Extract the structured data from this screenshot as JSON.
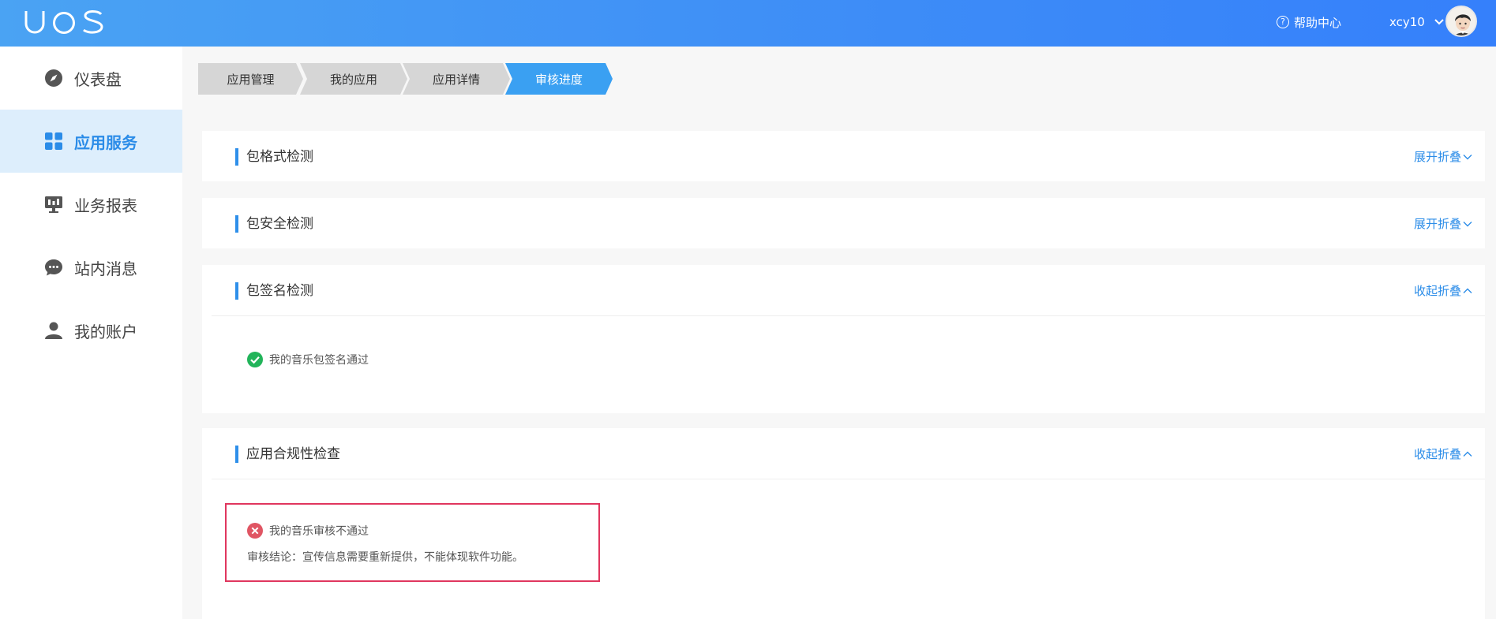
{
  "header": {
    "logo_text": "UOS",
    "help_label": "帮助中心",
    "username": "xcy10"
  },
  "sidebar": {
    "items": [
      {
        "label": "仪表盘",
        "icon": "compass-icon",
        "active": false
      },
      {
        "label": "应用服务",
        "icon": "grid-icon",
        "active": true
      },
      {
        "label": "业务报表",
        "icon": "report-icon",
        "active": false
      },
      {
        "label": "站内消息",
        "icon": "chat-icon",
        "active": false
      },
      {
        "label": "我的账户",
        "icon": "user-icon",
        "active": false
      }
    ]
  },
  "breadcrumb": [
    {
      "label": "应用管理",
      "active": false
    },
    {
      "label": "我的应用",
      "active": false
    },
    {
      "label": "应用详情",
      "active": false
    },
    {
      "label": "审核进度",
      "active": true
    }
  ],
  "sections": [
    {
      "title": "包格式检测",
      "toggle": "展开折叠",
      "expanded": false
    },
    {
      "title": "包安全检测",
      "toggle": "展开折叠",
      "expanded": false
    },
    {
      "title": "包签名检测",
      "toggle": "收起折叠",
      "expanded": true,
      "result": {
        "status": "pass",
        "text": "我的音乐包签名通过"
      }
    },
    {
      "title": "应用合规性检查",
      "toggle": "收起折叠",
      "expanded": true,
      "result": {
        "status": "fail",
        "text": "我的音乐审核不通过",
        "conclusion": "审核结论：宣传信息需要重新提供，不能体现软件功能。"
      }
    }
  ],
  "colors": {
    "accent": "#2b8ce8",
    "header_start": "#4aa3f3",
    "header_end": "#3580fb",
    "active_nav_bg": "#ddeefc",
    "pass": "#22b45a",
    "fail": "#e05563",
    "highlight_border": "#e0365e"
  }
}
